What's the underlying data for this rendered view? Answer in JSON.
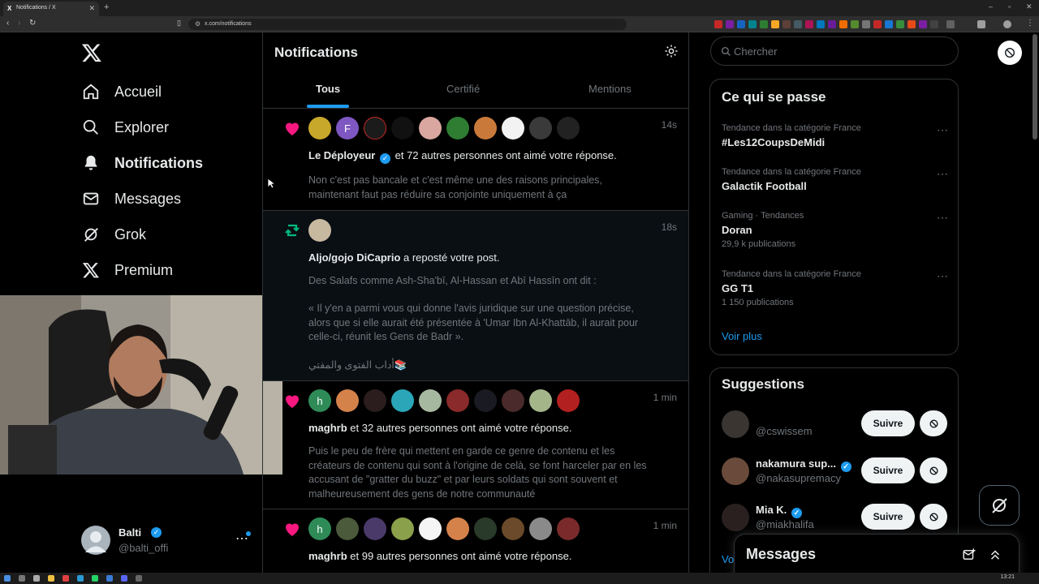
{
  "browser": {
    "tab_title": "Notifications / X",
    "url": "x.com/notifications"
  },
  "colors": {
    "accent": "#1d9bf0",
    "like": "#f91880",
    "repost": "#00ba7c",
    "bg": "#000000",
    "border": "#2f3336",
    "muted": "#71767b"
  },
  "nav": {
    "logo": "x-logo-icon",
    "items": [
      {
        "label": "Accueil",
        "icon": "home-icon"
      },
      {
        "label": "Explorer",
        "icon": "search-icon"
      },
      {
        "label": "Notifications",
        "icon": "bell-icon",
        "active": true
      },
      {
        "label": "Messages",
        "icon": "mail-icon"
      },
      {
        "label": "Grok",
        "icon": "grok-icon"
      },
      {
        "label": "Premium",
        "icon": "x-logo-icon"
      }
    ]
  },
  "account": {
    "name": "Balti",
    "handle": "@balti_offi",
    "more": "⋯"
  },
  "main": {
    "title": "Notifications",
    "tabs": [
      "Tous",
      "Certifié",
      "Mentions"
    ],
    "notifications": [
      {
        "type": "like",
        "time": "14s",
        "actor": "Le Déployeur",
        "verified": true,
        "action": "et 72 autres personnes ont aimé votre réponse.",
        "body": "Non c'est pas bancale et c'est même une des raisons principales, maintenant faut pas réduire sa conjointe uniquement à ça",
        "avatar_labels": [
          "",
          "F",
          "",
          "",
          "",
          "",
          "",
          "",
          "",
          ""
        ]
      },
      {
        "type": "repost",
        "time": "18s",
        "actor": "Aljo/gojo DiCaprio",
        "action": "a reposté votre post.",
        "body_lines": [
          "Des Salafs comme Ash-Sha'bī, Al-Hassan et Abī Hassīn ont dit :",
          "« Il y'en a parmi vous qui donne l'avis juridique sur une question précise, alors que si elle aurait été présentée à 'Umar Ibn Al-Khattāb, il aurait pour celle-ci, réunit les Gens de Badr ».",
          "أداب الفتوى والمفتي📚"
        ]
      },
      {
        "type": "like",
        "time": "1 min",
        "actor": "maghrb",
        "action": "et 32 autres personnes ont aimé votre réponse.",
        "body": "Puis le peu de frère qui mettent en garde ce genre de contenu et les créateurs de contenu qui sont à l'origine de celà, se font harceler par en les accusant de \"gratter du buzz\" et par leurs soldats qui sont souvent et malheureusement des gens de notre communauté",
        "avatar_labels": [
          "h",
          "",
          "",
          "",
          "",
          "",
          "",
          "",
          "",
          ""
        ]
      },
      {
        "type": "like",
        "time": "1 min",
        "actor": "maghrb",
        "action": "et 99 autres personnes ont aimé votre réponse.",
        "avatar_labels": [
          "h",
          "",
          "",
          "",
          "",
          "",
          "",
          "",
          "",
          ""
        ]
      }
    ]
  },
  "right": {
    "search_placeholder": "Chercher",
    "trends_title": "Ce qui se passe",
    "trends": [
      {
        "context": "Tendance dans la catégorie France",
        "name": "#Les12CoupsDeMidi",
        "count": ""
      },
      {
        "context": "Tendance dans la catégorie France",
        "name": "Galactik Football",
        "count": ""
      },
      {
        "context": "Gaming · Tendances",
        "name": "Doran",
        "count": "29,9 k publications"
      },
      {
        "context": "Tendance dans la catégorie France",
        "name": "GG T1",
        "count": "1 150 publications"
      }
    ],
    "show_more": "Voir plus",
    "suggestions_title": "Suggestions",
    "suggestions": [
      {
        "name": "",
        "handle": "@cswissem",
        "verified": false,
        "follow": "Suivre"
      },
      {
        "name": "nakamura sup...",
        "handle": "@nakasupremacy",
        "verified": true,
        "follow": "Suivre"
      },
      {
        "name": "Mia K.",
        "handle": "@miakhalifa",
        "verified": true,
        "follow": "Suivre"
      }
    ],
    "suggestions_more": "Vo"
  },
  "messages_bar": {
    "title": "Messages"
  },
  "taskbar": {
    "time": "13:21"
  }
}
